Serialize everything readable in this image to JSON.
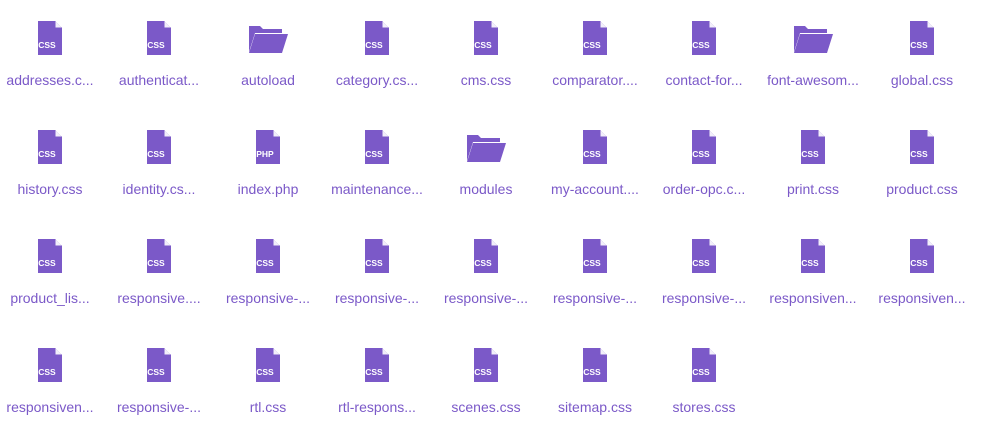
{
  "accent_color": "#7b59c8",
  "files": [
    {
      "name": "addresses.c...",
      "type": "css",
      "icon": "css-file-icon"
    },
    {
      "name": "authenticat...",
      "type": "css",
      "icon": "css-file-icon"
    },
    {
      "name": "autoload",
      "type": "folder",
      "icon": "folder-icon"
    },
    {
      "name": "category.cs...",
      "type": "css",
      "icon": "css-file-icon"
    },
    {
      "name": "cms.css",
      "type": "css",
      "icon": "css-file-icon"
    },
    {
      "name": "comparator....",
      "type": "css",
      "icon": "css-file-icon"
    },
    {
      "name": "contact-for...",
      "type": "css",
      "icon": "css-file-icon"
    },
    {
      "name": "font-awesom...",
      "type": "folder",
      "icon": "folder-icon"
    },
    {
      "name": "global.css",
      "type": "css",
      "icon": "css-file-icon"
    },
    {
      "name": "history.css",
      "type": "css",
      "icon": "css-file-icon"
    },
    {
      "name": "identity.cs...",
      "type": "css",
      "icon": "css-file-icon"
    },
    {
      "name": "index.php",
      "type": "php",
      "icon": "php-file-icon"
    },
    {
      "name": "maintenance...",
      "type": "css",
      "icon": "css-file-icon"
    },
    {
      "name": "modules",
      "type": "folder",
      "icon": "folder-icon"
    },
    {
      "name": "my-account....",
      "type": "css",
      "icon": "css-file-icon"
    },
    {
      "name": "order-opc.c...",
      "type": "css",
      "icon": "css-file-icon"
    },
    {
      "name": "print.css",
      "type": "css",
      "icon": "css-file-icon"
    },
    {
      "name": "product.css",
      "type": "css",
      "icon": "css-file-icon"
    },
    {
      "name": "product_lis...",
      "type": "css",
      "icon": "css-file-icon"
    },
    {
      "name": "responsive....",
      "type": "css",
      "icon": "css-file-icon"
    },
    {
      "name": "responsive-...",
      "type": "css",
      "icon": "css-file-icon"
    },
    {
      "name": "responsive-...",
      "type": "css",
      "icon": "css-file-icon"
    },
    {
      "name": "responsive-...",
      "type": "css",
      "icon": "css-file-icon"
    },
    {
      "name": "responsive-...",
      "type": "css",
      "icon": "css-file-icon"
    },
    {
      "name": "responsive-...",
      "type": "css",
      "icon": "css-file-icon"
    },
    {
      "name": "responsiven...",
      "type": "css",
      "icon": "css-file-icon"
    },
    {
      "name": "responsiven...",
      "type": "css",
      "icon": "css-file-icon"
    },
    {
      "name": "responsiven...",
      "type": "css",
      "icon": "css-file-icon"
    },
    {
      "name": "responsive-...",
      "type": "css",
      "icon": "css-file-icon"
    },
    {
      "name": "rtl.css",
      "type": "css",
      "icon": "css-file-icon"
    },
    {
      "name": "rtl-respons...",
      "type": "css",
      "icon": "css-file-icon"
    },
    {
      "name": "scenes.css",
      "type": "css",
      "icon": "css-file-icon"
    },
    {
      "name": "sitemap.css",
      "type": "css",
      "icon": "css-file-icon"
    },
    {
      "name": "stores.css",
      "type": "css",
      "icon": "css-file-icon"
    }
  ],
  "icon_badges": {
    "css": "CSS",
    "php": "PHP"
  }
}
